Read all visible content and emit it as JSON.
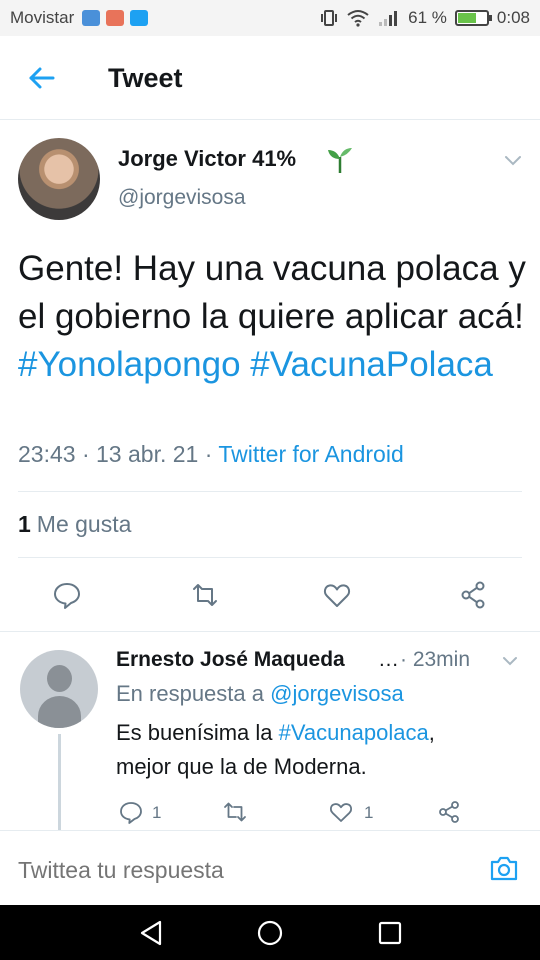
{
  "status_bar": {
    "carrier": "Movistar",
    "app_icons": [
      "voicemail-icon",
      "mail-icon",
      "twitter-icon"
    ],
    "battery_percent": "61 %",
    "battery_level": 0.61,
    "time": "0:08",
    "colors": {
      "voicemail": "#4a90d9",
      "mail": "#e8735a",
      "twitter": "#1da1f2",
      "battery": "#69c34a"
    }
  },
  "header": {
    "title": "Tweet",
    "back_icon": "arrow-left-icon",
    "accent": "#1da1f2"
  },
  "tweet": {
    "author_name": "Jorge Victor 41%",
    "author_emoji": "sprout-icon",
    "handle": "@jorgevisosa",
    "text_plain": "Gente! Hay una vacuna polaca y el gobierno la quiere aplicar acá!",
    "hashtags": [
      "#Yonolapongo",
      "#VacunaPolaca"
    ],
    "time": "23:43",
    "date": "13 abr. 21",
    "source": "Twitter for Android",
    "separator": "·",
    "likes_count": "1",
    "likes_label": "Me gusta",
    "actions": [
      "reply-icon",
      "retweet-icon",
      "like-icon",
      "share-icon"
    ]
  },
  "reply": {
    "author_name": "Ernesto José Maqueda",
    "ellipsis": "…",
    "time": "· 23min",
    "reply_to_prefix": "En respuesta a",
    "reply_to_handle": "@jorgevisosa",
    "text_prefix": "Es buenísima la",
    "hashtag": "#Vacunapolaca",
    "text_suffix": ",",
    "text_line2": "mejor que la de Moderna.",
    "reply_count": "1",
    "like_count": "1"
  },
  "compose": {
    "placeholder": "Twittea tu respuesta",
    "camera_icon": "camera-icon"
  },
  "navbar": {
    "buttons": [
      "back-triangle-icon",
      "home-circle-icon",
      "recents-square-icon"
    ]
  },
  "colors": {
    "link": "#1b95e0",
    "secondary_text": "#657786",
    "divider": "#e6ecf0"
  }
}
